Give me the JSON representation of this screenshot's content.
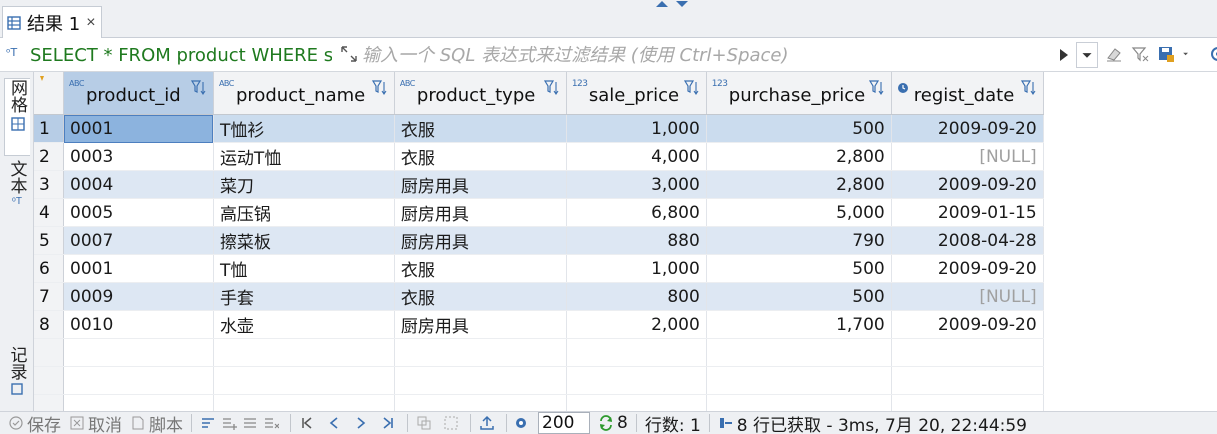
{
  "tab": {
    "label": "结果 1",
    "close": "×"
  },
  "filter": {
    "sql": "SELECT * FROM product WHERE sa",
    "placeholder": "输入一个 SQL 表达式来过滤结果 (使用 Ctrl+Space)",
    "sql_icon": "sql-type-icon"
  },
  "side_tabs": {
    "grid": "网格",
    "text": "文本",
    "record": "记录"
  },
  "columns": [
    {
      "name": "product_id",
      "type": "ABC"
    },
    {
      "name": "product_name",
      "type": "ABC"
    },
    {
      "name": "product_type",
      "type": "ABC"
    },
    {
      "name": "sale_price",
      "type": "123"
    },
    {
      "name": "purchase_price",
      "type": "123"
    },
    {
      "name": "regist_date",
      "type": "date"
    }
  ],
  "rows": [
    {
      "n": "1",
      "id": "0001",
      "name": "T恤衫",
      "type": "衣服",
      "sale": "1,000",
      "purchase": "500",
      "date": "2009-09-20"
    },
    {
      "n": "2",
      "id": "0003",
      "name": "运动T恤",
      "type": "衣服",
      "sale": "4,000",
      "purchase": "2,800",
      "date": "[NULL]"
    },
    {
      "n": "3",
      "id": "0004",
      "name": "菜刀",
      "type": "厨房用具",
      "sale": "3,000",
      "purchase": "2,800",
      "date": "2009-09-20"
    },
    {
      "n": "4",
      "id": "0005",
      "name": "高压锅",
      "type": "厨房用具",
      "sale": "6,800",
      "purchase": "5,000",
      "date": "2009-01-15"
    },
    {
      "n": "5",
      "id": "0007",
      "name": "擦菜板",
      "type": "厨房用具",
      "sale": "880",
      "purchase": "790",
      "date": "2008-04-28"
    },
    {
      "n": "6",
      "id": "0001",
      "name": "T恤",
      "type": "衣服",
      "sale": "1,000",
      "purchase": "500",
      "date": "2009-09-20"
    },
    {
      "n": "7",
      "id": "0009",
      "name": "手套",
      "type": "衣服",
      "sale": "800",
      "purchase": "500",
      "date": "[NULL]"
    },
    {
      "n": "8",
      "id": "0010",
      "name": "水壶",
      "type": "厨房用具",
      "sale": "2,000",
      "purchase": "1,700",
      "date": "2009-09-20"
    }
  ],
  "bottom": {
    "save": "保存",
    "cancel": "取消",
    "script": "脚本",
    "fetch_size": "200",
    "refresh_count": "8",
    "row_count": "行数: 1",
    "status": "8 行已获取 - 3ms, 7月 20, 22:44:59"
  },
  "colors": {
    "selected_header": "#b7cde6",
    "alt_row": "#dde7f3",
    "focus_cell": "#8cb3de",
    "sql_text": "#1f7a1f"
  }
}
